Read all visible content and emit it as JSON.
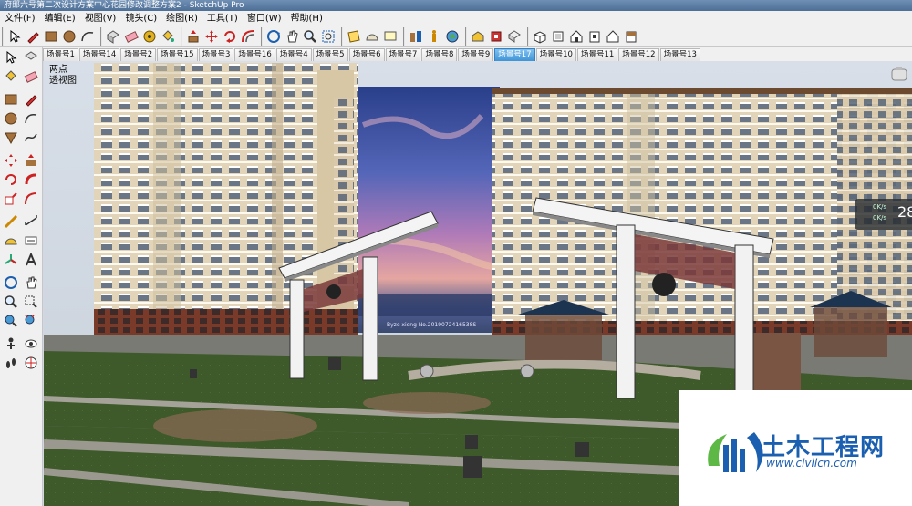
{
  "window": {
    "title": "府邸六号第二次设计方案中心花园修改调整方案2 - SketchUp Pro"
  },
  "menu": [
    {
      "label": "文件(F)"
    },
    {
      "label": "编辑(E)"
    },
    {
      "label": "视图(V)"
    },
    {
      "label": "镜头(C)"
    },
    {
      "label": "绘图(R)"
    },
    {
      "label": "工具(T)"
    },
    {
      "label": "窗口(W)"
    },
    {
      "label": "帮助(H)"
    }
  ],
  "scene_tabs": [
    {
      "label": "场景号1"
    },
    {
      "label": "场景号14"
    },
    {
      "label": "场景号2"
    },
    {
      "label": "场景号15"
    },
    {
      "label": "场景号3"
    },
    {
      "label": "场景号16"
    },
    {
      "label": "场景号4"
    },
    {
      "label": "场景号5"
    },
    {
      "label": "场景号6"
    },
    {
      "label": "场景号7"
    },
    {
      "label": "场景号8"
    },
    {
      "label": "场景号9"
    },
    {
      "label": "场景号17"
    },
    {
      "label": "场景号10"
    },
    {
      "label": "场景号11"
    },
    {
      "label": "场景号12"
    },
    {
      "label": "场景号13"
    }
  ],
  "active_tab": "场景号17",
  "viewport": {
    "perspective_line1": "两点",
    "perspective_line2": "透视图",
    "photo_caption": "Byze xiong No.2019072416538S"
  },
  "net_meter": {
    "up": "0K/s",
    "down": "0K/s",
    "value": "28"
  },
  "watermark": {
    "brand": "土木工程网",
    "url": "www.civilcn.com"
  },
  "colors": {
    "active_tab": "#3f94d6",
    "logo": "#1b5fb0",
    "building": "#e2d4b8",
    "lawn": "#3e5a2a"
  },
  "toolbar_icons": [
    "select-icon",
    "pencil-icon",
    "rectangle-icon",
    "circle-icon",
    "arc-icon",
    "eraser-icon",
    "paint-bucket-icon",
    "push-pull-icon",
    "move-icon",
    "rotate-icon",
    "offset-icon",
    "orbit-icon",
    "pan-icon",
    "zoom-icon",
    "zoom-extents-icon",
    "section-plane-icon",
    "tape-measure-icon",
    "axes-icon",
    "iso-view-icon",
    "top-view-icon",
    "front-view-icon",
    "right-view-icon",
    "back-view-icon",
    "left-view-icon"
  ]
}
